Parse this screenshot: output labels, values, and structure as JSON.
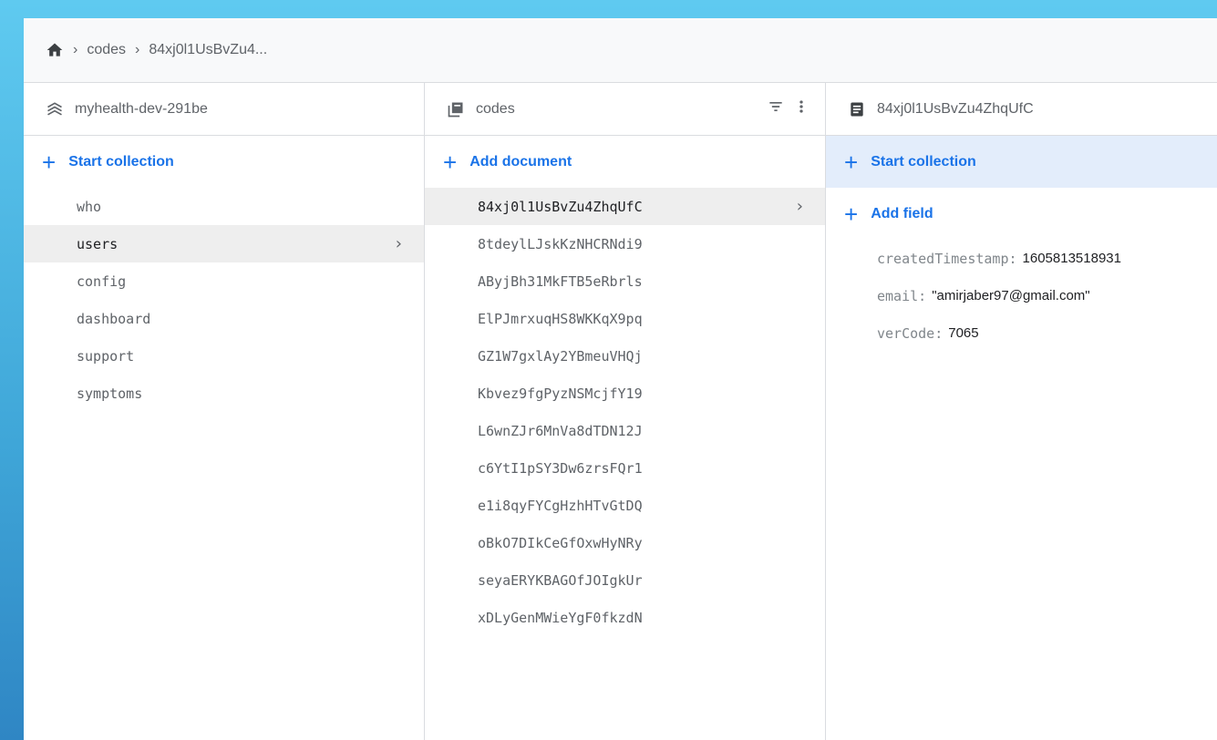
{
  "breadcrumb": {
    "items": [
      "codes",
      "84xj0l1UsBvZu4..."
    ]
  },
  "project": {
    "name": "myhealth-dev-291be",
    "start_collection_label": "Start collection",
    "collections": [
      {
        "label": "who",
        "selected": false
      },
      {
        "label": "users",
        "selected": true
      },
      {
        "label": "config",
        "selected": false
      },
      {
        "label": "dashboard",
        "selected": false
      },
      {
        "label": "support",
        "selected": false
      },
      {
        "label": "symptoms",
        "selected": false
      }
    ]
  },
  "collection": {
    "name": "codes",
    "add_document_label": "Add document",
    "documents": [
      {
        "label": "84xj0l1UsBvZu4ZhqUfC",
        "selected": true
      },
      {
        "label": "8tdeylLJskKzNHCRNdi9",
        "selected": false
      },
      {
        "label": "AByjBh31MkFTB5eRbrls",
        "selected": false
      },
      {
        "label": "ElPJmrxuqHS8WKKqX9pq",
        "selected": false
      },
      {
        "label": "GZ1W7gxlAy2YBmeuVHQj",
        "selected": false
      },
      {
        "label": "Kbvez9fgPyzNSMcjfY19",
        "selected": false
      },
      {
        "label": "L6wnZJr6MnVa8dTDN12J",
        "selected": false
      },
      {
        "label": "c6YtI1pSY3Dw6zrsFQr1",
        "selected": false
      },
      {
        "label": "e1i8qyFYCgHzhHTvGtDQ",
        "selected": false
      },
      {
        "label": "oBkO7DIkCeGfOxwHyNRy",
        "selected": false
      },
      {
        "label": "seyaERYKBAGOfJOIgkUr",
        "selected": false
      },
      {
        "label": "xDLyGenMWieYgF0fkzdN",
        "selected": false
      }
    ]
  },
  "document": {
    "name": "84xj0l1UsBvZu4ZhqUfC",
    "start_collection_label": "Start collection",
    "add_field_label": "Add field",
    "fields": [
      {
        "key": "createdTimestamp:",
        "value": "1605813518931"
      },
      {
        "key": "email:",
        "value": "\"amirjaber97@gmail.com\""
      },
      {
        "key": "verCode:",
        "value": "7065"
      }
    ]
  },
  "colors": {
    "accent": "#1a73e8",
    "selected_row": "#eeeeee",
    "highlight_row": "#e3edfb"
  }
}
